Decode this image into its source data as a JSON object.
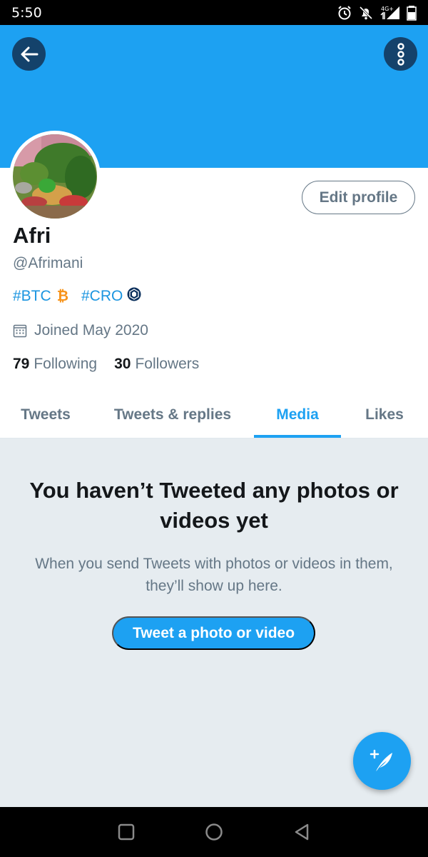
{
  "status_bar": {
    "time": "5:50",
    "network": "4G+",
    "icons": [
      "alarm-icon",
      "notifications-off-icon",
      "signal-icon",
      "battery-icon"
    ]
  },
  "header": {
    "back_icon": "arrow-left-icon",
    "more_icon": "more-vertical-icon",
    "banner_color": "#1da1f2"
  },
  "profile": {
    "edit_button": "Edit profile",
    "display_name": "Afri",
    "handle": "@Afrimani",
    "bio_tags": [
      "#BTC",
      "#CRO"
    ],
    "btc_symbol": "₿",
    "joined": "Joined May 2020",
    "following_count": "79",
    "following_label": "Following",
    "followers_count": "30",
    "followers_label": "Followers"
  },
  "tabs": [
    {
      "label": "Tweets",
      "active": false
    },
    {
      "label": "Tweets & replies",
      "active": false
    },
    {
      "label": "Media",
      "active": true
    },
    {
      "label": "Likes",
      "active": false
    }
  ],
  "empty_state": {
    "title": "You haven’t Tweeted any photos or videos yet",
    "description": "When you send Tweets with photos or videos in them, they’ll show up here.",
    "button": "Tweet a photo or video"
  },
  "fab": {
    "icon": "compose-tweet-icon"
  },
  "colors": {
    "accent": "#1da1f2",
    "secondary_text": "#657786",
    "primary_text": "#14171a",
    "empty_bg": "#e6ecf0"
  }
}
